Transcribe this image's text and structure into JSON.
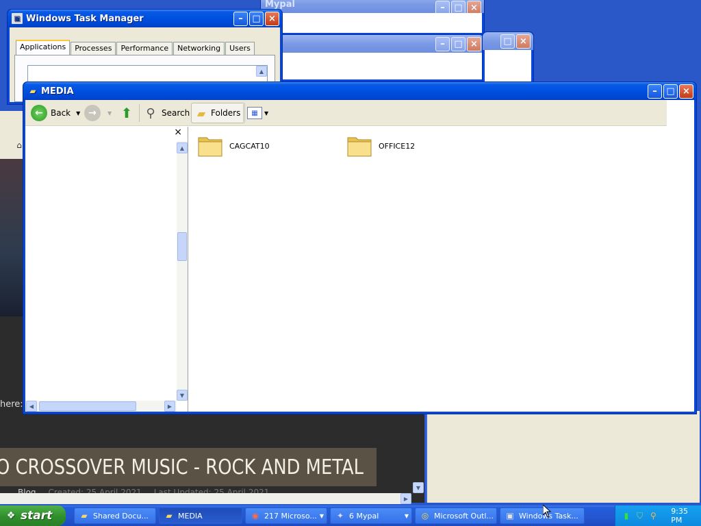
{
  "windows": {
    "mypal_top": {
      "title": "Mypal"
    },
    "task_manager": {
      "title": "Windows Task Manager",
      "tabs": [
        "Applications",
        "Processes",
        "Performance",
        "Networking",
        "Users"
      ]
    },
    "media": {
      "title": "MEDIA",
      "toolbar": {
        "back": "Back",
        "search": "Search",
        "folders": "Folders"
      },
      "folders": [
        "CAGCAT10",
        "OFFICE12"
      ],
      "close_glyph": "×"
    }
  },
  "web": {
    "nav_fragment": "here:",
    "headline": "O CROSSOVER MUSIC - ROCK AND METAL",
    "meta": {
      "category": "Blog",
      "created": "Created: 25 April 2021",
      "updated": "Last Updated: 25 April 2021"
    }
  },
  "taskbar": {
    "start": "start",
    "tasks": [
      "Shared Docu...",
      "MEDIA",
      "217 Microso...",
      "6 Mypal",
      "Microsoft Outl...",
      "Windows Task..."
    ],
    "clock": "9:35 PM"
  },
  "colors": {
    "title_active": "#0050e0",
    "taskbar": "#245edc",
    "start_green": "#3c9f37"
  }
}
